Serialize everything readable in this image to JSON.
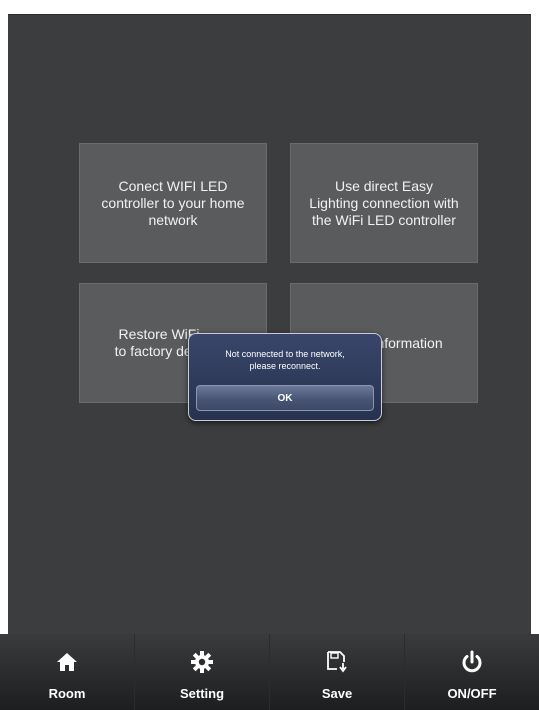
{
  "tiles": [
    {
      "label": "Conect WIFI LED\ncontroller to your home\nnetwork"
    },
    {
      "label": "Use direct Easy\nLighting connection with\nthe WiFi LED controller"
    },
    {
      "label": "Restore WiFi\nto factory defa"
    },
    {
      "label": "information"
    }
  ],
  "dialog": {
    "message": "Not connected to the network,\nplease reconnect.",
    "ok_label": "OK"
  },
  "tabbar": {
    "items": [
      {
        "label": "Room",
        "icon": "home-icon"
      },
      {
        "label": "Setting",
        "icon": "gear-icon"
      },
      {
        "label": "Save",
        "icon": "save-icon"
      },
      {
        "label": "ON/OFF",
        "icon": "power-icon"
      }
    ]
  }
}
